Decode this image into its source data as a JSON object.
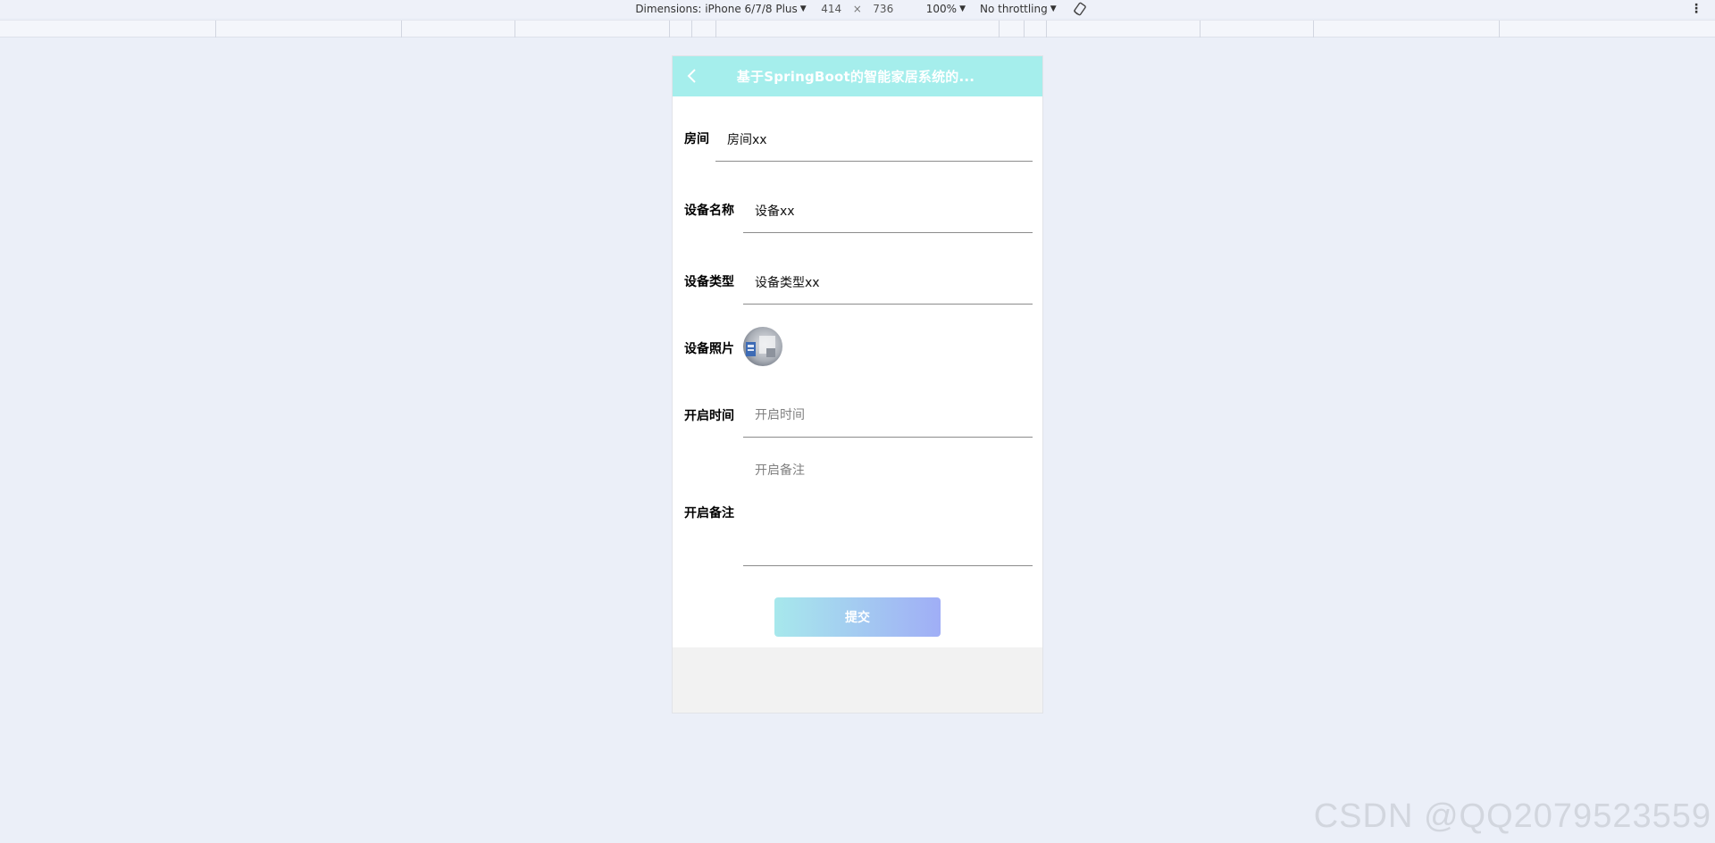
{
  "devtools": {
    "dimensions_label": "Dimensions: iPhone 6/7/8 Plus",
    "width": "414",
    "times": "×",
    "height": "736",
    "zoom": "100%",
    "throttling": "No throttling",
    "menu_icon": "more-vertical-icon",
    "rotate_icon": "rotate-icon"
  },
  "header": {
    "title": "基于SpringBoot的智能家居系统的...",
    "back_icon": "chevron-left-icon",
    "background": "#a5eeec"
  },
  "form": {
    "room": {
      "label": "房间",
      "value": "房间xx"
    },
    "device_name": {
      "label": "设备名称",
      "value": "设备xx"
    },
    "device_type": {
      "label": "设备类型",
      "value": "设备类型xx"
    },
    "device_photo": {
      "label": "设备照片"
    },
    "open_time": {
      "label": "开启时间",
      "placeholder": "开启时间"
    },
    "open_note": {
      "label": "开启备注",
      "placeholder": "开启备注"
    }
  },
  "submit": {
    "label": "提交",
    "gradient_from": "#a7e8ec",
    "gradient_to": "#a0aef6"
  },
  "watermark": "CSDN @QQ2079523559"
}
